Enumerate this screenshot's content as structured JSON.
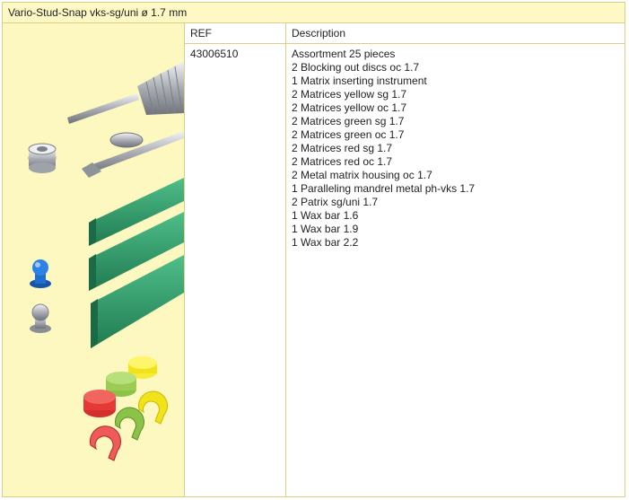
{
  "title": "Vario-Stud-Snap vks-sg/uni ø 1.7 mm",
  "table": {
    "headers": {
      "ref": "REF",
      "description": "Description"
    },
    "rows": [
      {
        "ref": "43006510",
        "description": [
          "Assortment 25 pieces",
          "2 Blocking out discs oc 1.7",
          "1 Matrix inserting instrument",
          "2 Matrices yellow sg 1.7",
          "2 Matrices yellow oc 1.7",
          "2 Matrices green sg 1.7",
          "2 Matrices green oc 1.7",
          "2 Matrices red sg 1.7",
          "2 Matrices red oc 1.7",
          "2 Metal matrix housing oc 1.7",
          "1 Paralleling mandrel metal ph-vks 1.7",
          "2 Patrix sg/uni 1.7",
          "1 Wax bar 1.6",
          "1 Wax bar 1.9",
          "1 Wax bar 2.2"
        ]
      }
    ]
  },
  "colors": {
    "panel_background": "#fdf7c0",
    "border": "#d8cf8a",
    "wax_bar": "#2e9a6a",
    "matrix_yellow": "#f2e21a",
    "matrix_green": "#8bc34a",
    "matrix_red": "#e53935",
    "patrix_blue": "#1e6fd0",
    "metal": "#b8bcc2"
  }
}
